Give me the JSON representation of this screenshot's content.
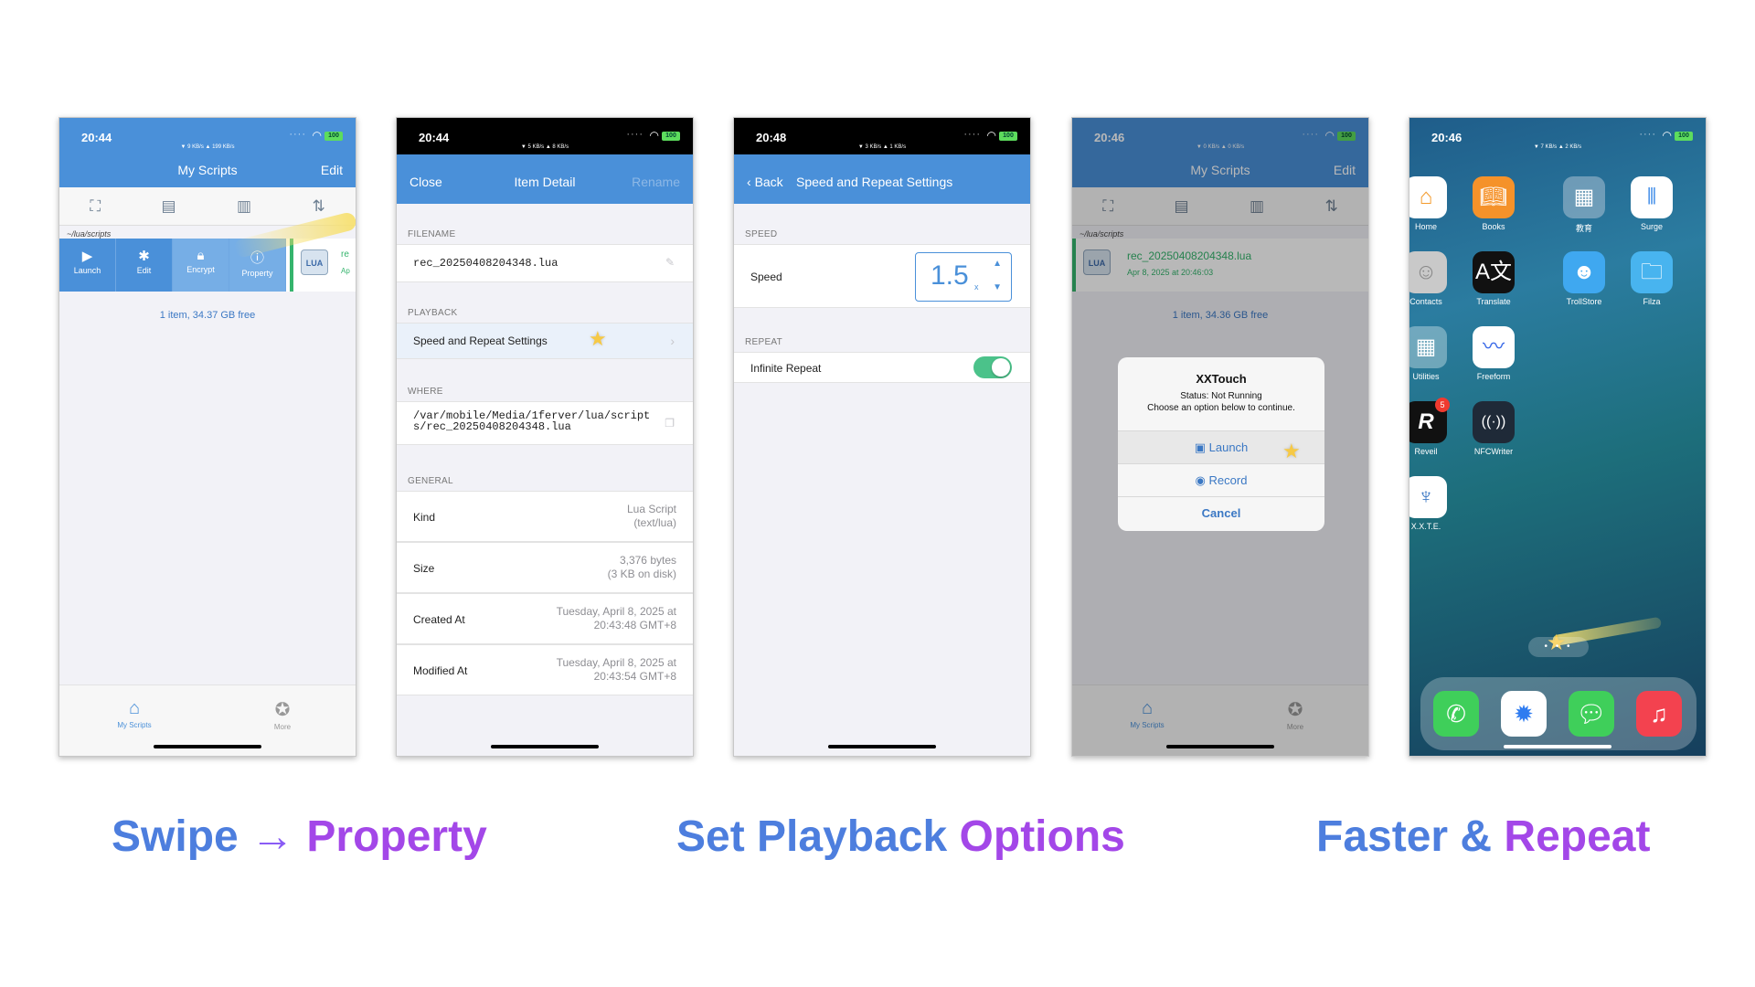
{
  "captions": {
    "swipe": "Swipe",
    "arrow": "→",
    "property": "Property",
    "set": "Set Playback",
    "options": "Options",
    "faster": "Faster &",
    "repeat": "Repeat"
  },
  "screen1": {
    "time": "20:44",
    "speeds": "▼ 9 KB/s    ▲ 199 KB/s",
    "battery": "100",
    "title": "My Scripts",
    "edit": "Edit",
    "path": "~/lua/scripts",
    "actions": [
      "Launch",
      "Edit",
      "Encrypt",
      "Property"
    ],
    "file_badge": "LUA",
    "file_partial": "re",
    "file_partial2": "Ap",
    "footer": "1 item, 34.37 GB free",
    "tabs": [
      "My Scripts",
      "More"
    ]
  },
  "screen2": {
    "time": "20:44",
    "speeds": "▼ 5 KB/s    ▲ 8 KB/s",
    "battery": "100",
    "close": "Close",
    "title": "Item Detail",
    "rename": "Rename",
    "filename_label": "FILENAME",
    "filename": "rec_20250408204348.lua",
    "playback_label": "PLAYBACK",
    "playback_item": "Speed and Repeat Settings",
    "where_label": "WHERE",
    "where_value": "/var/mobile/Media/1ferver/lua/scripts/rec_20250408204348.lua",
    "general_label": "GENERAL",
    "rows": [
      {
        "label": "Kind",
        "value": "Lua Script\n(text/lua)"
      },
      {
        "label": "Size",
        "value": "3,376 bytes\n(3 KB on disk)"
      },
      {
        "label": "Created At",
        "value": "Tuesday, April 8, 2025 at\n20:43:48 GMT+8"
      },
      {
        "label": "Modified At",
        "value": "Tuesday, April 8, 2025 at\n20:43:54 GMT+8"
      }
    ]
  },
  "screen3": {
    "time": "20:48",
    "speeds": "▼ 3 KB/s    ▲ 1 KB/s",
    "battery": "100",
    "back": "Back",
    "title": "Speed and Repeat Settings",
    "speed_label": "SPEED",
    "speed_row": "Speed",
    "speed_value": "1.5",
    "speed_unit": "x",
    "repeat_label": "REPEAT",
    "repeat_row": "Infinite Repeat",
    "repeat_on": true
  },
  "screen4": {
    "time": "20:46",
    "speeds": "▼ 0 KB/s    ▲ 0 KB/s",
    "battery": "100",
    "title": "My Scripts",
    "edit": "Edit",
    "path": "~/lua/scripts",
    "file_name": "rec_20250408204348.lua",
    "file_date": "Apr 8, 2025 at 20:46:03",
    "file_badge": "LUA",
    "footer": "1 item, 34.36 GB free",
    "alert_title": "XXTouch",
    "alert_message": "Status: Not Running\nChoose an option below to continue.",
    "launch": "Launch",
    "record": "Record",
    "cancel": "Cancel",
    "tabs": [
      "My Scripts",
      "More"
    ]
  },
  "screen5": {
    "time": "20:46",
    "speeds": "▼ 7 KB/s    ▲ 2 KB/s",
    "battery": "100",
    "apps": [
      {
        "label": "Home"
      },
      {
        "label": "Books"
      },
      {
        "label": "教育"
      },
      {
        "label": "Surge"
      },
      {
        "label": "Contacts"
      },
      {
        "label": "Translate"
      },
      {
        "label": "TrollStore"
      },
      {
        "label": "Filza"
      },
      {
        "label": "Utilities"
      },
      {
        "label": "Freeform"
      },
      {
        "label": "Reveil",
        "badge": "5"
      },
      {
        "label": "NFCWriter"
      },
      {
        "label": "X.X.T.E."
      }
    ],
    "dock": [
      "phone-icon",
      "safari-icon",
      "messages-icon",
      "music-icon"
    ]
  }
}
